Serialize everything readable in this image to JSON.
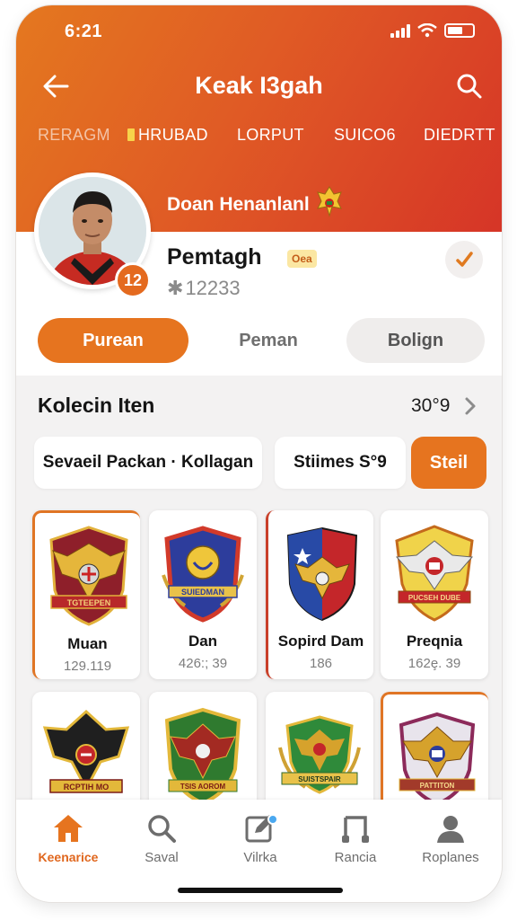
{
  "status_bar": {
    "time": "6:21"
  },
  "header": {
    "title": "Keak I3gah",
    "tabs": [
      "RERAGM",
      "HRUBAD",
      "LORPUT",
      "SUICO6",
      "DIEDRTT"
    ],
    "banner_name": "Doan Henanlanl"
  },
  "profile": {
    "name": "Pemtagh",
    "tag": "Oea",
    "id": "12233",
    "level": "12"
  },
  "segments": [
    "Purean",
    "Peman",
    "Bolign"
  ],
  "collection": {
    "title": "Kolecin Iten",
    "count": "30°9",
    "filters": [
      "Sevaeil  Packan · Kollagan",
      "Stiimes S°9"
    ],
    "filter_button": "Steil",
    "items": [
      {
        "name": "Muan",
        "value": "129.119",
        "crest_text": "TGTEEPEN"
      },
      {
        "name": "Dan",
        "value": "426:; 39",
        "crest_text": "SUIEDMAN"
      },
      {
        "name": "Sopird Dam",
        "value": "186",
        "crest_text": ""
      },
      {
        "name": "Preqnia",
        "value": "162ȩ. 39",
        "crest_text": "PUCSEH DUBE"
      },
      {
        "name": "",
        "value": "",
        "crest_text": "RCPTIH MO"
      },
      {
        "name": "",
        "value": "",
        "crest_text": "TSIS AOROM"
      },
      {
        "name": "",
        "value": "",
        "crest_text": "SUISTSPAIR"
      },
      {
        "name": "",
        "value": "",
        "crest_text": "PATTITON"
      }
    ]
  },
  "bottom_nav": [
    {
      "label": "Keenarice",
      "icon": "home-icon"
    },
    {
      "label": "Saval",
      "icon": "search-icon"
    },
    {
      "label": "Vilrka",
      "icon": "edit-icon"
    },
    {
      "label": "Rancia",
      "icon": "music-icon"
    },
    {
      "label": "Roplanes",
      "icon": "profile-icon"
    }
  ],
  "colors": {
    "accent": "#e6741f",
    "header_start": "#e4781f",
    "header_end": "#d63527"
  }
}
